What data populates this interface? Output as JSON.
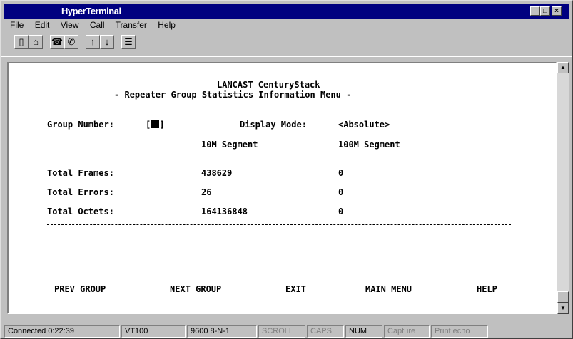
{
  "window": {
    "title": "HyperTerminal"
  },
  "menu": [
    "File",
    "Edit",
    "View",
    "Call",
    "Transfer",
    "Help"
  ],
  "toolbar": {
    "icons": [
      "new-icon",
      "open-icon",
      "connect-icon",
      "disconnect-icon",
      "send-icon",
      "receive-icon",
      "properties-icon"
    ]
  },
  "terminal": {
    "header_line1": "LANCAST CenturyStack",
    "header_line2": "- Repeater Group Statistics Information Menu -",
    "group_label": "Group Number:",
    "group_value": "[",
    "group_close": "]",
    "display_label": "Display Mode:",
    "display_value": "<Absolute>",
    "col1": "10M Segment",
    "col2": "100M Segment",
    "rows": [
      {
        "label": "Total Frames:",
        "v1": "438629",
        "v2": "0"
      },
      {
        "label": "Total Errors:",
        "v1": "26",
        "v2": "0"
      },
      {
        "label": "Total Octets:",
        "v1": "164136848",
        "v2": "0"
      }
    ],
    "commands": [
      "PREV GROUP",
      "NEXT GROUP",
      "EXIT",
      "MAIN MENU",
      "HELP"
    ]
  },
  "status": {
    "connected": "Connected 0:22:39",
    "emulation": "VT100",
    "settings": "9600 8-N-1",
    "scroll": "SCROLL",
    "caps": "CAPS",
    "num": "NUM",
    "capture": "Capture",
    "print": "Print echo"
  }
}
